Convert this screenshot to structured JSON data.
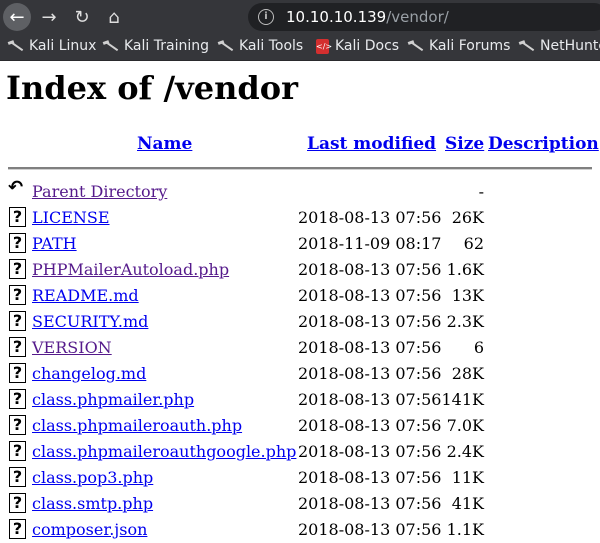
{
  "browser": {
    "url_host": "10.10.10.139",
    "url_path": "/vendor/",
    "bookmarks": [
      {
        "label": "Kali Linux",
        "icon": "kali-dragon-icon"
      },
      {
        "label": "Kali Training",
        "icon": "kali-dragon-icon"
      },
      {
        "label": "Kali Tools",
        "icon": "kali-dragon-icon"
      },
      {
        "label": "Kali Docs",
        "icon": "docs-icon"
      },
      {
        "label": "Kali Forums",
        "icon": "kali-dragon-icon"
      },
      {
        "label": "NetHunte",
        "icon": "kali-dragon-icon"
      }
    ]
  },
  "page": {
    "title": "Index of /vendor",
    "headers": {
      "name": "Name",
      "last_modified": "Last modified",
      "size": "Size",
      "description": "Description"
    },
    "entries": [
      {
        "name": "Parent Directory",
        "date": "",
        "size": "-",
        "description": "",
        "icon": "back-arrow-icon",
        "visited": true
      },
      {
        "name": "LICENSE",
        "date": "2018-08-13 07:56",
        "size": "26K",
        "description": "",
        "icon": "unknown-file-icon",
        "visited": false
      },
      {
        "name": "PATH",
        "date": "2018-11-09 08:17",
        "size": "62",
        "description": "",
        "icon": "unknown-file-icon",
        "visited": false
      },
      {
        "name": "PHPMailerAutoload.php",
        "date": "2018-08-13 07:56",
        "size": "1.6K",
        "description": "",
        "icon": "unknown-file-icon",
        "visited": true
      },
      {
        "name": "README.md",
        "date": "2018-08-13 07:56",
        "size": "13K",
        "description": "",
        "icon": "unknown-file-icon",
        "visited": false
      },
      {
        "name": "SECURITY.md",
        "date": "2018-08-13 07:56",
        "size": "2.3K",
        "description": "",
        "icon": "unknown-file-icon",
        "visited": false
      },
      {
        "name": "VERSION",
        "date": "2018-08-13 07:56",
        "size": "6",
        "description": "",
        "icon": "unknown-file-icon",
        "visited": true
      },
      {
        "name": "changelog.md",
        "date": "2018-08-13 07:56",
        "size": "28K",
        "description": "",
        "icon": "unknown-file-icon",
        "visited": false
      },
      {
        "name": "class.phpmailer.php",
        "date": "2018-08-13 07:56",
        "size": "141K",
        "description": "",
        "icon": "unknown-file-icon",
        "visited": false
      },
      {
        "name": "class.phpmaileroauth.php",
        "date": "2018-08-13 07:56",
        "size": "7.0K",
        "description": "",
        "icon": "unknown-file-icon",
        "visited": false
      },
      {
        "name": "class.phpmaileroauthgoogle.php",
        "date": "2018-08-13 07:56",
        "size": "2.4K",
        "description": "",
        "icon": "unknown-file-icon",
        "visited": false
      },
      {
        "name": "class.pop3.php",
        "date": "2018-08-13 07:56",
        "size": "11K",
        "description": "",
        "icon": "unknown-file-icon",
        "visited": false
      },
      {
        "name": "class.smtp.php",
        "date": "2018-08-13 07:56",
        "size": "41K",
        "description": "",
        "icon": "unknown-file-icon",
        "visited": false
      },
      {
        "name": "composer.json",
        "date": "2018-08-13 07:56",
        "size": "1.1K",
        "description": "",
        "icon": "unknown-file-icon",
        "visited": false
      }
    ]
  },
  "colors": {
    "link": "#0000ee",
    "visited_link": "#551a8b",
    "chrome_bg": "#35363a",
    "url_bar_bg": "#202124"
  }
}
